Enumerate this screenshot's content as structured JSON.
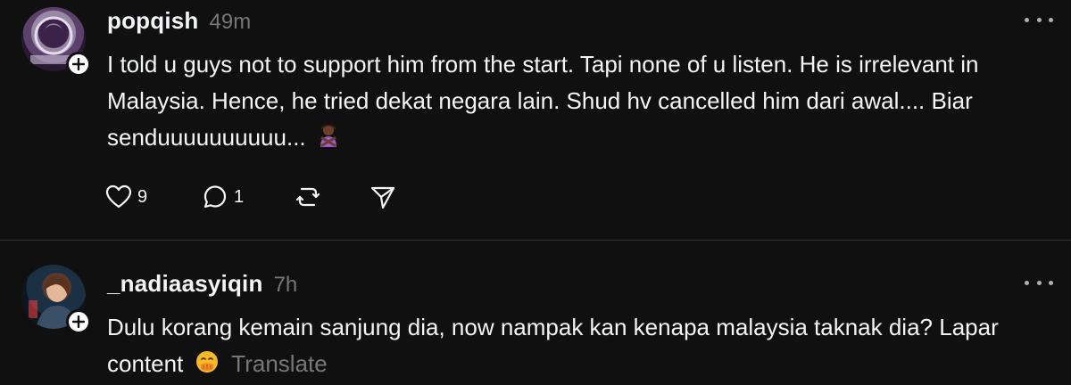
{
  "posts": [
    {
      "username": "popqish",
      "timestamp": "49m",
      "text": "I told u guys not to support him from the start. Tapi none of u listen. He is irrelevant in Malaysia. Hence, he tried dekat negara lain. Shud hv cancelled him dari awal.... Biar senduuuuuuuuuu...",
      "emoji": "person-gesturing-no-icon",
      "like_count": "9",
      "reply_count": "1"
    },
    {
      "username": "_nadiaasyiqin",
      "timestamp": "7h",
      "text": "Dulu korang kemain sanjung dia, now nampak kan kenapa malaysia taknak dia? Lapar content",
      "emoji": "hand-over-mouth-face-icon",
      "translate_label": "Translate"
    }
  ],
  "colors": {
    "background": "#101010",
    "text": "#f3f5f7",
    "muted": "#777777",
    "divider": "#2d2d2d"
  }
}
